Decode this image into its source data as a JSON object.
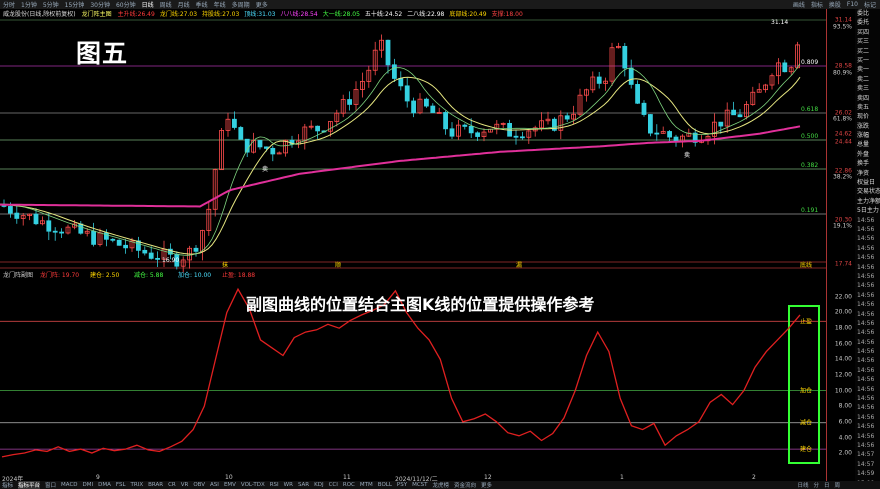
{
  "toolbar": {
    "items": [
      "分时",
      "1分钟",
      "5分钟",
      "15分钟",
      "30分钟",
      "60分钟",
      "日线",
      "周线",
      "月线",
      "季线",
      "年线",
      "多周期",
      "更多"
    ],
    "right_items": [
      "画线",
      "指标",
      "换股",
      "F10",
      "标记"
    ]
  },
  "info": {
    "stock": "威龙股份(日线,除权前复权)",
    "indicator": "龙门阵主图",
    "values": [
      {
        "label": "主升线:",
        "value": "26.49",
        "color": "#ff3b3b"
      },
      {
        "label": "龙门线:",
        "value": "27.03",
        "color": "#ffd700"
      },
      {
        "label": "持股线:",
        "value": "27.03",
        "color": "#ffd700"
      },
      {
        "label": "顶线:",
        "value": "31.03",
        "color": "#4de0ff"
      },
      {
        "label": "八八线:",
        "value": "28.54",
        "color": "#ff44ff"
      },
      {
        "label": "大一线:",
        "value": "28.05",
        "color": "#44ff44"
      },
      {
        "label": "五十线:",
        "value": "24.52",
        "color": "#ffffff"
      },
      {
        "label": "二八线:",
        "value": "22.98",
        "color": "#ffffff"
      },
      {
        "label": "底部线:",
        "value": "20.49",
        "color": "#ffd700"
      },
      {
        "label": "支撑:",
        "value": "18.00",
        "color": "#ff4444"
      }
    ]
  },
  "overlay": {
    "title": "图五",
    "subtitle": "副图曲线的位置结合主图K线的位置提供操作参考"
  },
  "main_axis": [
    {
      "label": "31.14"
    },
    {
      "label": "28.58"
    },
    {
      "label": "26.02"
    },
    {
      "label": "24.62"
    },
    {
      "label": "24.44"
    },
    {
      "label": "22.86"
    },
    {
      "label": "20.30"
    },
    {
      "label": "17.74"
    }
  ],
  "main_pct": [
    {
      "label": "93.5%"
    },
    {
      "label": "80.9%"
    },
    {
      "label": "61.8%"
    },
    {
      "label": "38.2%"
    },
    {
      "label": "19.1%"
    }
  ],
  "fib_labels": [
    "0.809",
    "0.618",
    "0.500",
    "0.382",
    "0.191"
  ],
  "annotations": {
    "top_price": "31.14",
    "low_price": "16.90",
    "sell1": "卖",
    "buy1": "买",
    "bottom_labels": [
      "抹",
      "顺",
      "漏",
      "底线"
    ]
  },
  "sub": {
    "header": "龙门阵副图",
    "values": [
      {
        "label": "龙门阵:",
        "value": "19.70",
        "color": "#ff3b3b"
      },
      {
        "label": "建仓:",
        "value": "2.50",
        "color": "#ffd700"
      },
      {
        "label": "减仓:",
        "value": "5.88",
        "color": "#44ff44"
      },
      {
        "label": "加仓:",
        "value": "10.00",
        "color": "#4de0ff"
      },
      {
        "label": "止盈:",
        "value": "18.88",
        "color": "#ff3b3b"
      }
    ],
    "axis": [
      "22.00",
      "20.00",
      "18.00",
      "16.00",
      "14.00",
      "12.00",
      "10.00",
      "8.00",
      "6.00",
      "4.00",
      "2.00"
    ],
    "levels": [
      "止盈",
      "加仓",
      "减仓",
      "建仓"
    ]
  },
  "dates": [
    "2024年",
    "9",
    "10",
    "11",
    "2024/11/12/二",
    "12",
    "1",
    "2"
  ],
  "sidebar": [
    "委比",
    "委托",
    "买四",
    "买三",
    "买二",
    "买一",
    "卖一",
    "卖二",
    "卖三",
    "卖四",
    "卖五",
    "现价",
    "涨跌",
    "涨幅",
    "总量",
    "外盘",
    "换手",
    "净资",
    "权益日",
    "交易状态",
    "主力净额",
    "5日主力",
    "14:56",
    "14:56",
    "14:56",
    "14:56",
    "14:56",
    "14:56",
    "14:56",
    "14:56",
    "14:56",
    "14:56",
    "14:56",
    "14:56",
    "14:56",
    "14:56",
    "14:56",
    "14:56",
    "14:56",
    "14:56",
    "14:56",
    "14:56",
    "14:56",
    "14:56",
    "14:56",
    "14:56",
    "14:56",
    "14:57",
    "14:57",
    "14:59",
    "15:00"
  ],
  "bottom": [
    "指标",
    "指标平台",
    "窗口",
    "MACD",
    "DMI",
    "DMA",
    "FSL",
    "TRIX",
    "BRAR",
    "CR",
    "VR",
    "OBV",
    "ASI",
    "EMV",
    "VOL-TDX",
    "RSI",
    "WR",
    "SAR",
    "KDJ",
    "CCI",
    "ROC",
    "MTM",
    "BOLL",
    "PSY",
    "MCST",
    "龙虎榜",
    "资金流向",
    "更多"
  ],
  "bottom_right": [
    "日线",
    "分",
    "日",
    "周"
  ],
  "chart_data": {
    "type": "line",
    "title": "龙门阵副图",
    "series": [
      {
        "name": "龙门阵",
        "values": [
          1.5,
          1.8,
          2.0,
          2.4,
          2.2,
          2.8,
          2.2,
          2.5,
          2.0,
          2.6,
          2.3,
          2.5,
          3.0,
          2.4,
          2.2,
          2.8,
          3.5,
          5.0,
          8.0,
          14.0,
          20.0,
          23.0,
          20.5,
          16.5,
          15.5,
          14.5,
          16.8,
          17.5,
          17.8,
          18.5,
          18.0,
          19.0,
          19.7,
          20.3,
          21.0,
          22.8,
          20.0,
          18.0,
          16.5,
          14.0,
          9.0,
          6.0,
          6.4,
          7.0,
          6.0,
          4.6,
          4.2,
          4.8,
          3.6,
          4.5,
          6.5,
          10.0,
          14.5,
          17.5,
          15.0,
          9.0,
          5.5,
          5.0,
          5.8,
          3.0,
          4.2,
          5.0,
          6.0,
          8.5,
          9.5,
          8.2,
          10.0,
          13.0,
          15.0,
          16.5,
          18.0,
          19.7
        ]
      }
    ],
    "ylim": [
      0,
      22
    ]
  }
}
